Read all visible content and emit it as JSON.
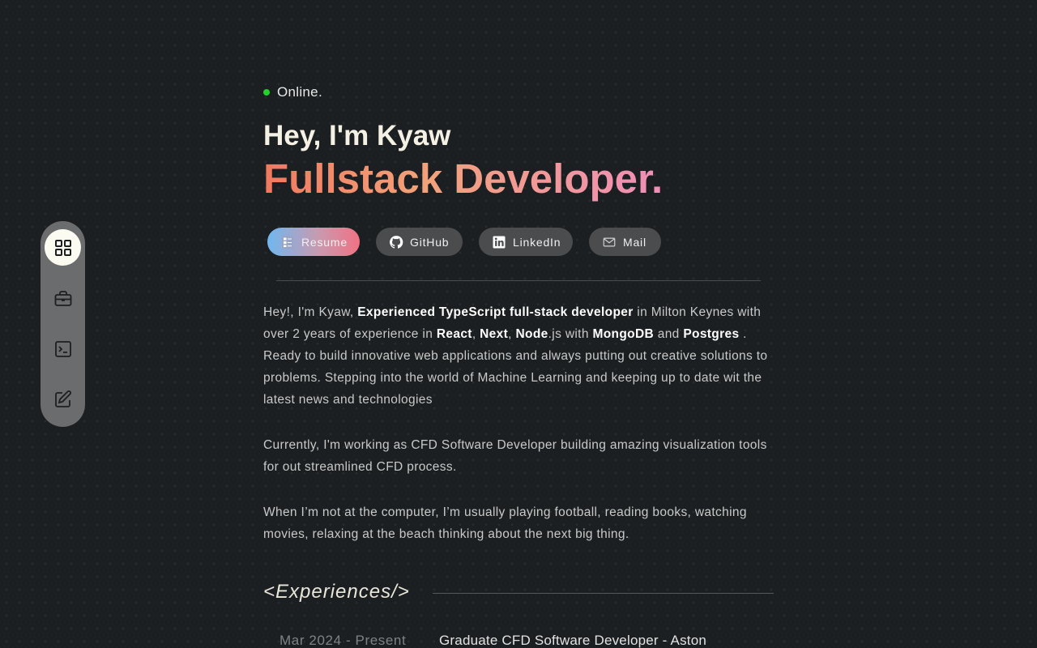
{
  "sidebar": {
    "items": [
      {
        "name": "grid-icon",
        "active": true
      },
      {
        "name": "briefcase-icon",
        "active": false
      },
      {
        "name": "terminal-icon",
        "active": false
      },
      {
        "name": "edit-icon",
        "active": false
      }
    ]
  },
  "status": {
    "label": "Online.",
    "color": "#22d12a"
  },
  "hero": {
    "greeting": "Hey, I'm Kyaw",
    "role": "Fullstack Developer."
  },
  "links": {
    "resume": "Resume",
    "github": "GitHub",
    "linkedin": "LinkedIn",
    "mail": "Mail"
  },
  "about": {
    "p1": [
      {
        "t": "Hey!, I'm Kyaw, "
      },
      {
        "t": "Experienced TypeScript full-stack developer",
        "b": true
      },
      {
        "t": " in Milton Keynes with over 2 years of experience in "
      },
      {
        "t": "React",
        "b": true
      },
      {
        "t": ", "
      },
      {
        "t": "Next",
        "b": true
      },
      {
        "t": ", "
      },
      {
        "t": "Node",
        "b": true
      },
      {
        "t": ".js with "
      },
      {
        "t": "MongoDB",
        "b": true
      },
      {
        "t": " and "
      },
      {
        "t": "Postgres",
        "b": true
      },
      {
        "t": " . Ready to build innovative web applications and always putting out creative solutions to problems. Stepping into the world of Machine Learning and keeping up to date wit the latest news and technologies"
      }
    ],
    "p2": "Currently, I'm working as CFD Software Developer building amazing visualization tools for out streamlined CFD process.",
    "p3": "When I’m not at the computer, I’m usually playing football, reading books, watching movies, relaxing at the beach thinking about the next big thing."
  },
  "experiences": {
    "title": "<Experiences/>",
    "items": [
      {
        "date": "Mar 2024 - Present",
        "title": "Graduate CFD Software Developer - Aston"
      }
    ]
  },
  "colors": {
    "background": "#1c1f21",
    "dock": "#6a6c6d",
    "accent_gradient": [
      "#f0795f",
      "#f2a27a",
      "#ef8fb8"
    ]
  }
}
